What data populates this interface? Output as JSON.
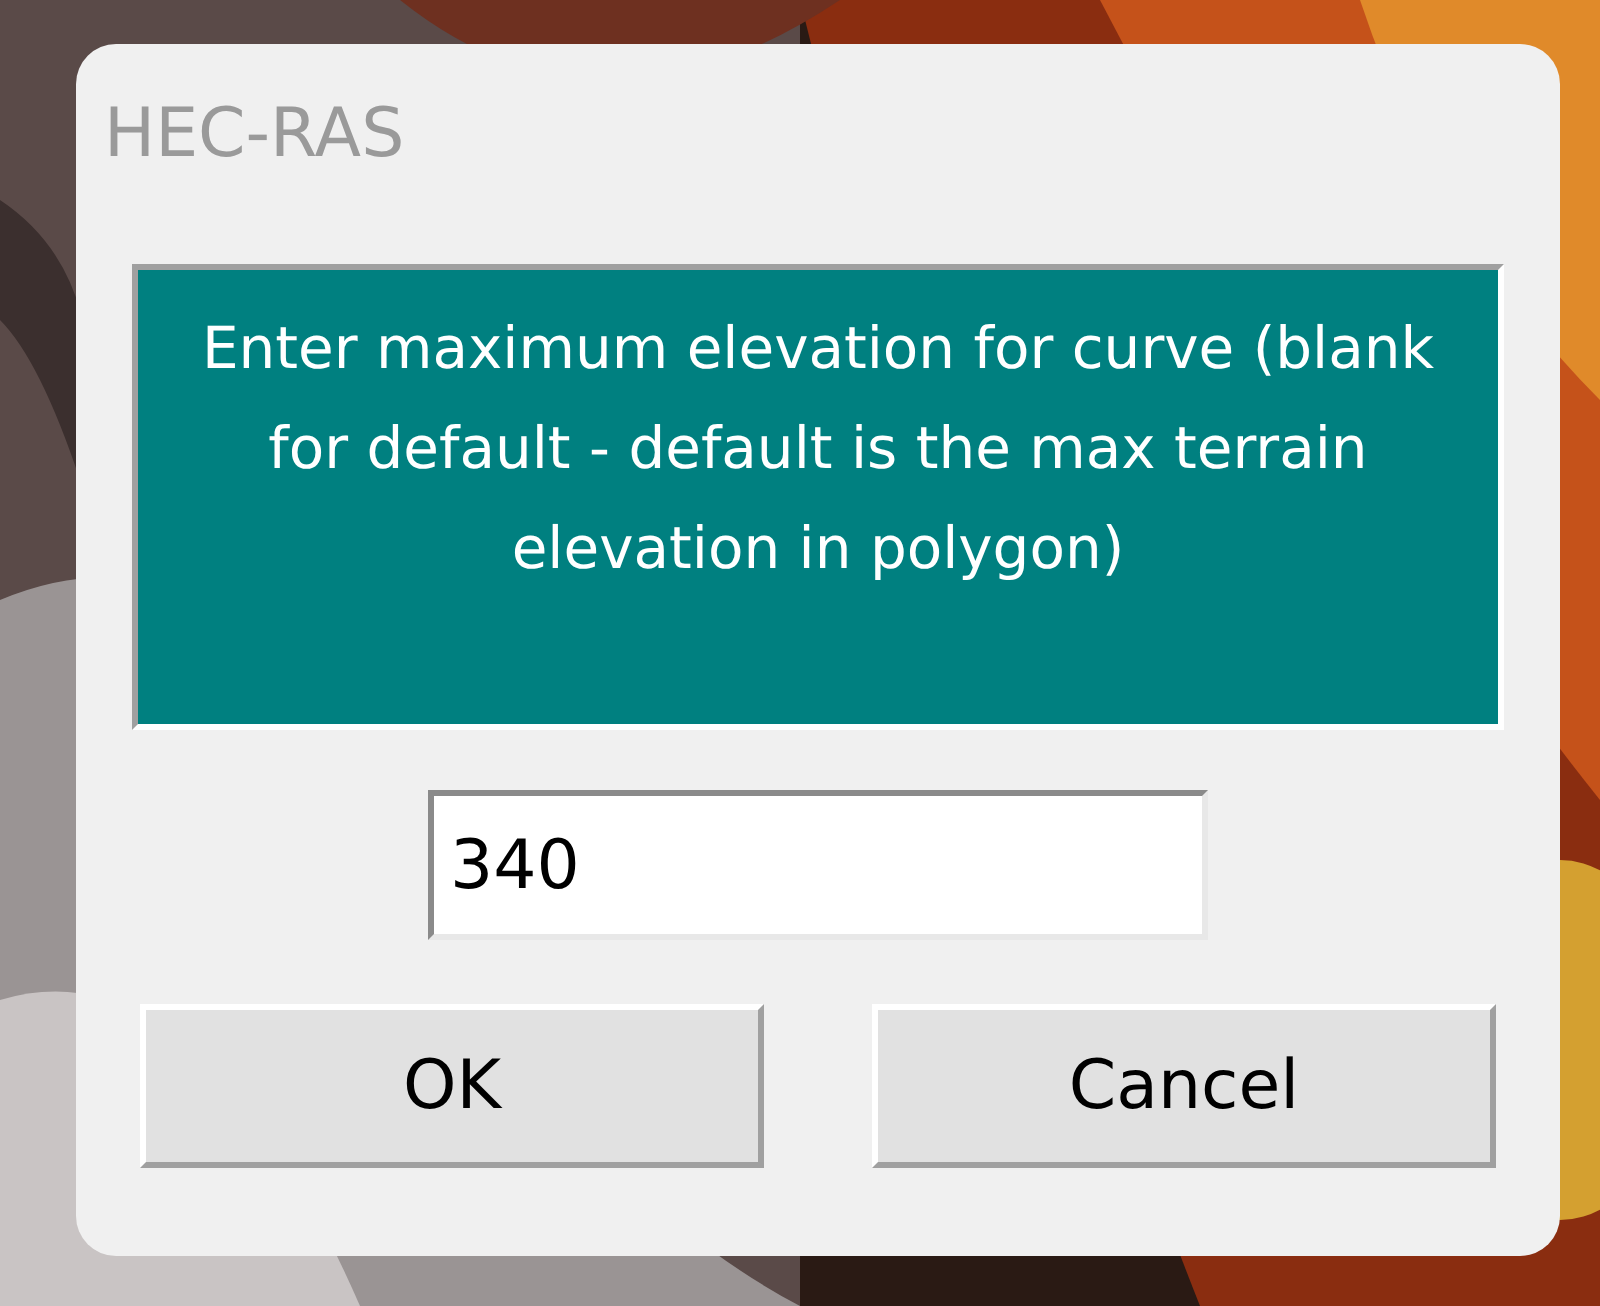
{
  "dialog": {
    "title": "HEC-RAS",
    "message": "Enter maximum elevation for curve (blank for default - default is the max terrain elevation in polygon)",
    "field": {
      "value": "340"
    },
    "buttons": [
      "OK",
      "Cancel"
    ]
  }
}
